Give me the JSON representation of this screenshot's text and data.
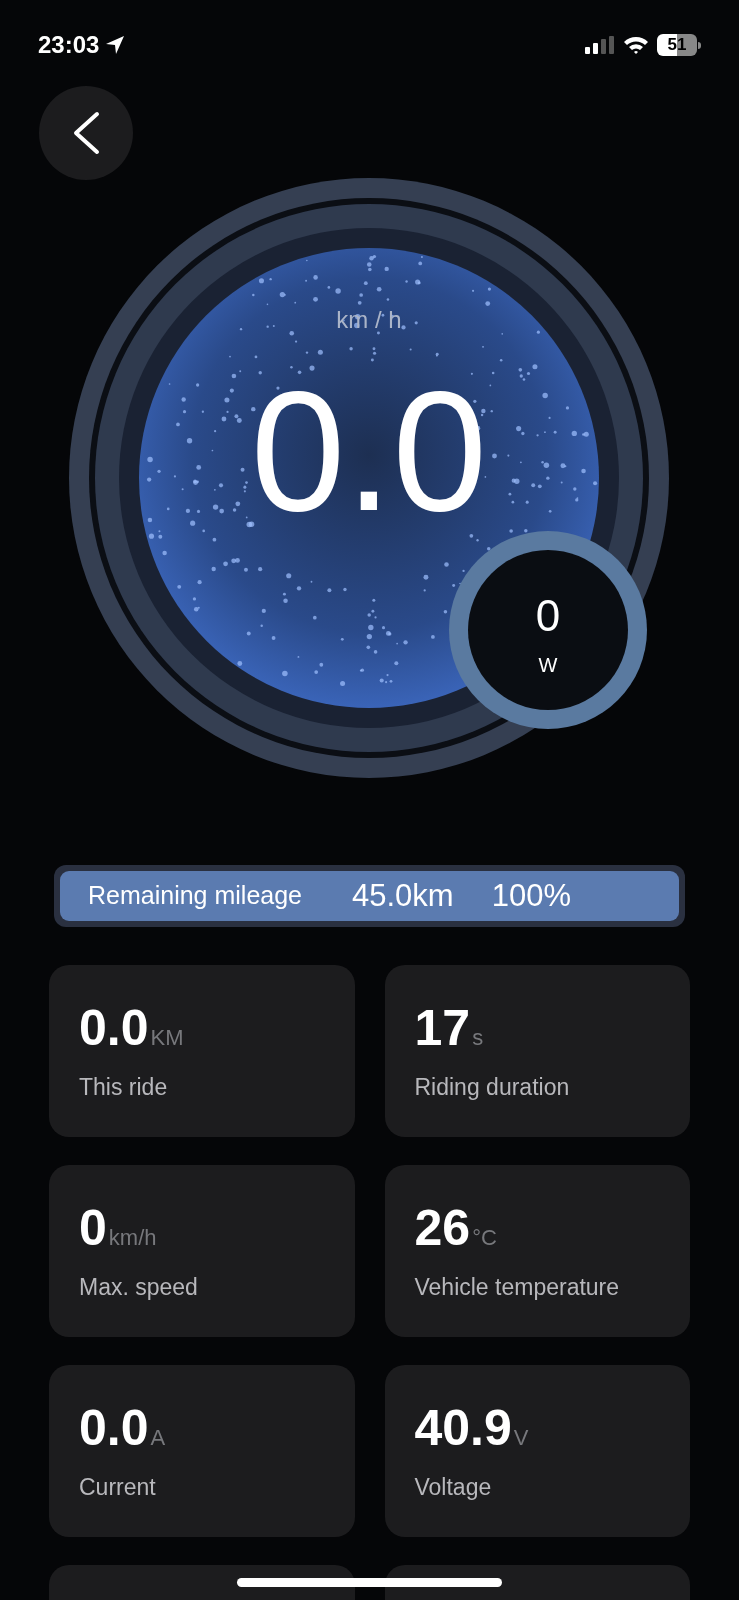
{
  "status_bar": {
    "time": "23:03",
    "battery": "51"
  },
  "gauge": {
    "unit": "km / h",
    "speed": "0.0",
    "power": "0",
    "power_unit": "W"
  },
  "mileage": {
    "label": "Remaining mileage",
    "distance": "45.0km",
    "percent": "100%",
    "level": 1
  },
  "stats": [
    {
      "value": "0.0",
      "unit": "KM",
      "label": "This ride"
    },
    {
      "value": "17",
      "unit": "s",
      "label": "Riding duration"
    },
    {
      "value": "0",
      "unit": "km/h",
      "label": "Max. speed"
    },
    {
      "value": "26",
      "unit": "°C",
      "label": "Vehicle temperature"
    },
    {
      "value": "0.0",
      "unit": "A",
      "label": "Current"
    },
    {
      "value": "40.9",
      "unit": "V",
      "label": "Voltage"
    }
  ]
}
